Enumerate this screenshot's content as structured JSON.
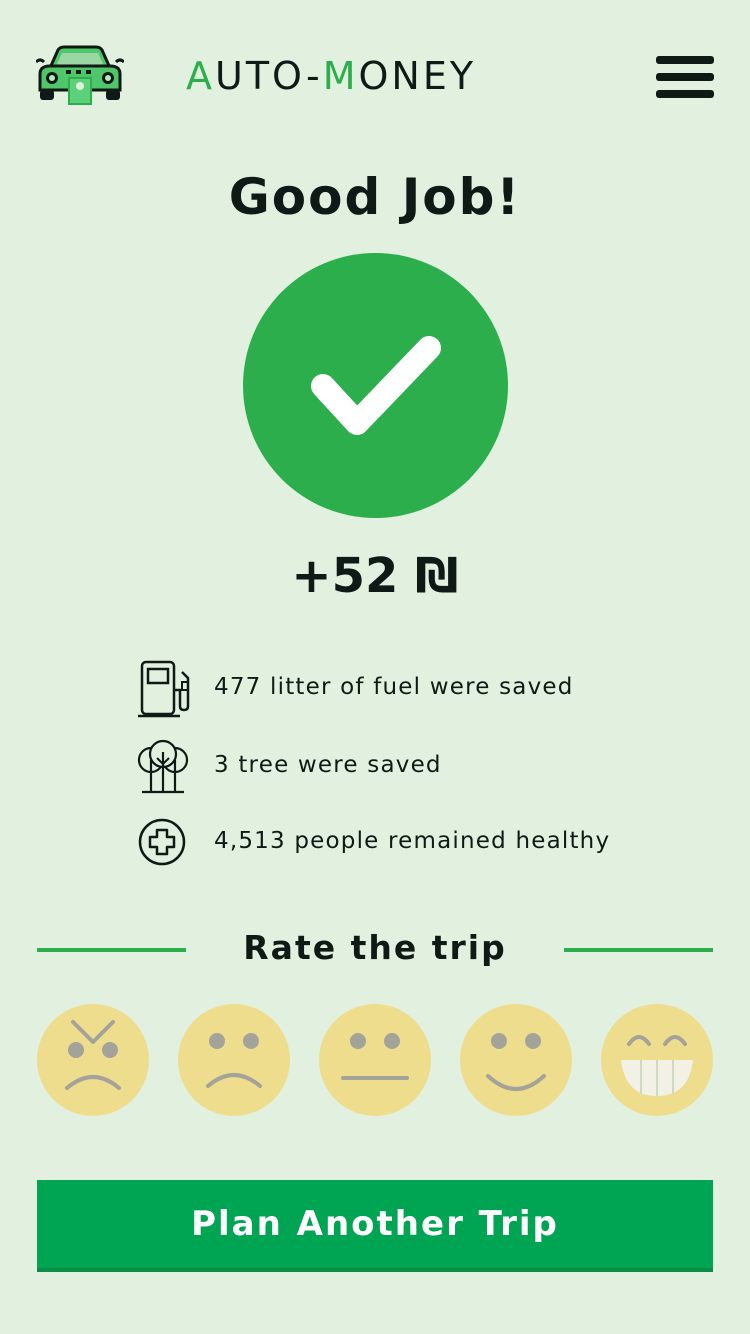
{
  "header": {
    "brand_part1": "A",
    "brand_part2": "UT",
    "brand_part3": "O-",
    "brand_part4": "M",
    "brand_part5": "ONEY",
    "logo_icon": "car-money-icon",
    "menu_icon": "hamburger-menu-icon"
  },
  "result": {
    "title": "Good Job!",
    "status_icon": "check-circle-icon",
    "amount": "+52 ₪"
  },
  "stats": [
    {
      "icon": "fuel-pump-icon",
      "text": "477 litter of fuel were saved"
    },
    {
      "icon": "trees-icon",
      "text": "3 tree were saved"
    },
    {
      "icon": "health-cross-icon",
      "text": "4,513 people remained healthy"
    }
  ],
  "rating": {
    "title": "Rate the trip",
    "faces": [
      "angry-face-icon",
      "sad-face-icon",
      "neutral-face-icon",
      "smile-face-icon",
      "grin-face-icon"
    ]
  },
  "cta": {
    "label": "Plan Another Trip"
  },
  "colors": {
    "background": "#e2f0df",
    "accent_green": "#2bae4b",
    "button_green": "#00a553",
    "text_dark": "#0f1a17",
    "face_yellow": "#eedd8c"
  }
}
